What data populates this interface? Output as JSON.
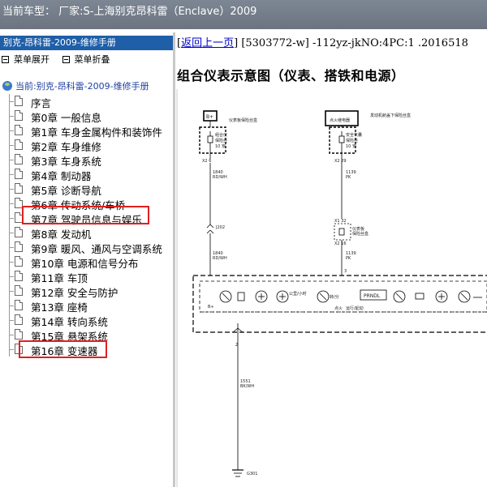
{
  "titlebar": {
    "text": "当前车型： 厂家:S-上海别克昂科雷（Enclave）2009"
  },
  "left": {
    "panel_title": "别克-昂科雷-2009-维修手册",
    "toolbar": {
      "expand": "菜单展开",
      "collapse": "菜单折叠"
    },
    "root_label": "当前:别克-昂科雷-2009-维修手册",
    "items": [
      "序言",
      "第0章 一般信息",
      "第1章 车身金属构件和装饰件",
      "第2章 车身维修",
      "第3章 车身系统",
      "第4章 制动器",
      "第5章 诊断导航",
      "第6章 传动系统/车桥",
      "第7章 驾驶员信息与娱乐",
      "第8章 发动机",
      "第9章 暖风、通风与空调系统",
      "第10章 电源和信号分布",
      "第11章 车顶",
      "第12章 安全与防护",
      "第13章 座椅",
      "第14章 转向系统",
      "第15章 悬架系统",
      "第16章 变速器"
    ]
  },
  "right": {
    "back_link": "返回上一页",
    "doc_code": "[5303772-w] -112yz-jkNO:4PC:1 .2016518",
    "heading": "组合仪表示意图（仪表、搭铁和电源）"
  },
  "diagram": {
    "left_box": "B+",
    "left_fuse_title": "仪表板保险丝盒",
    "left_fuse_a": "组合仪",
    "left_fuse_b": "保险丝",
    "left_fuse_c": "10 安",
    "left_pin": "X2  6",
    "left_wire": "1840",
    "left_wire_color": "RD/WH",
    "left_connector": "J202",
    "left_wire2": "1840",
    "left_wire2_color": "RD/WH",
    "left_b_plus": "B+",
    "right_box": "点火继电器",
    "right_fuse_title": "发动机舱盖下保险丝盒",
    "right_fuse_a": "安全气囊",
    "right_fuse_b": "保险丝",
    "right_fuse_c": "10 安",
    "right_pin": "X2  29",
    "right_wire": "1139",
    "right_wire_color": "PK",
    "right_x1": "X1  32",
    "right_x2": "X2  16",
    "right_fuse2_a": "仪表板",
    "right_fuse2_b": "保险丝盒",
    "right_wire2": "1139",
    "right_wire2_color": "PK",
    "right_pin3": "3",
    "prndl": "PRNDL",
    "cluster_ignition": "点火",
    "cluster_run": "运行/起动",
    "gauge_labels": [
      "公里/小时",
      "转/分"
    ],
    "ground_pin": "2",
    "ground_wire": "1551",
    "ground_wire_color": "BK/WH",
    "ground_name": "G301"
  }
}
